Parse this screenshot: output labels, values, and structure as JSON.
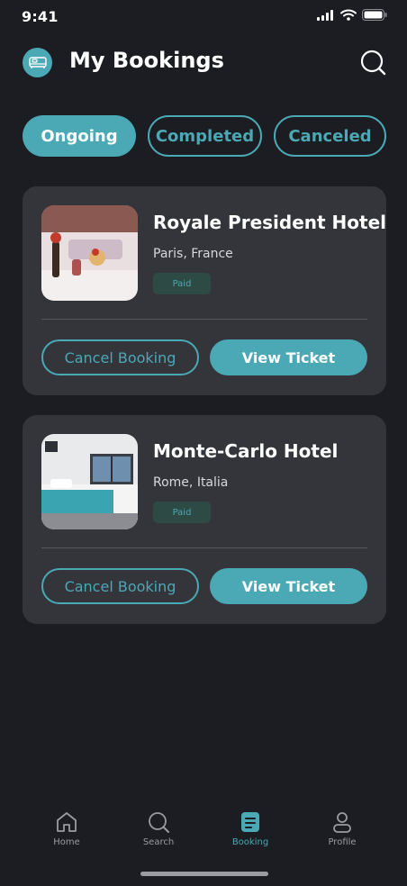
{
  "status_bar": {
    "time": "9:41"
  },
  "header": {
    "title": "My Bookings",
    "logo_icon": "bed-icon",
    "search_icon": "search-icon"
  },
  "tabs": [
    {
      "label": "Ongoing",
      "active": true
    },
    {
      "label": "Completed",
      "active": false
    },
    {
      "label": "Canceled",
      "active": false
    }
  ],
  "bookings": [
    {
      "name": "Royale President Hotel",
      "location": "Paris, France",
      "status": "Paid",
      "cancel_label": "Cancel Booking",
      "view_label": "View Ticket"
    },
    {
      "name": "Monte-Carlo Hotel",
      "location": "Rome, Italia",
      "status": "Paid",
      "cancel_label": "Cancel Booking",
      "view_label": "View Ticket"
    }
  ],
  "nav": [
    {
      "label": "Home",
      "icon": "home-icon",
      "active": false
    },
    {
      "label": "Search",
      "icon": "search-icon",
      "active": false
    },
    {
      "label": "Booking",
      "icon": "booking-icon",
      "active": true
    },
    {
      "label": "Profile",
      "icon": "profile-icon",
      "active": false
    }
  ],
  "colors": {
    "accent": "#4aa9b5",
    "background": "#1b1d22",
    "card": "#33353b",
    "badge_bg": "#2d4a44"
  }
}
